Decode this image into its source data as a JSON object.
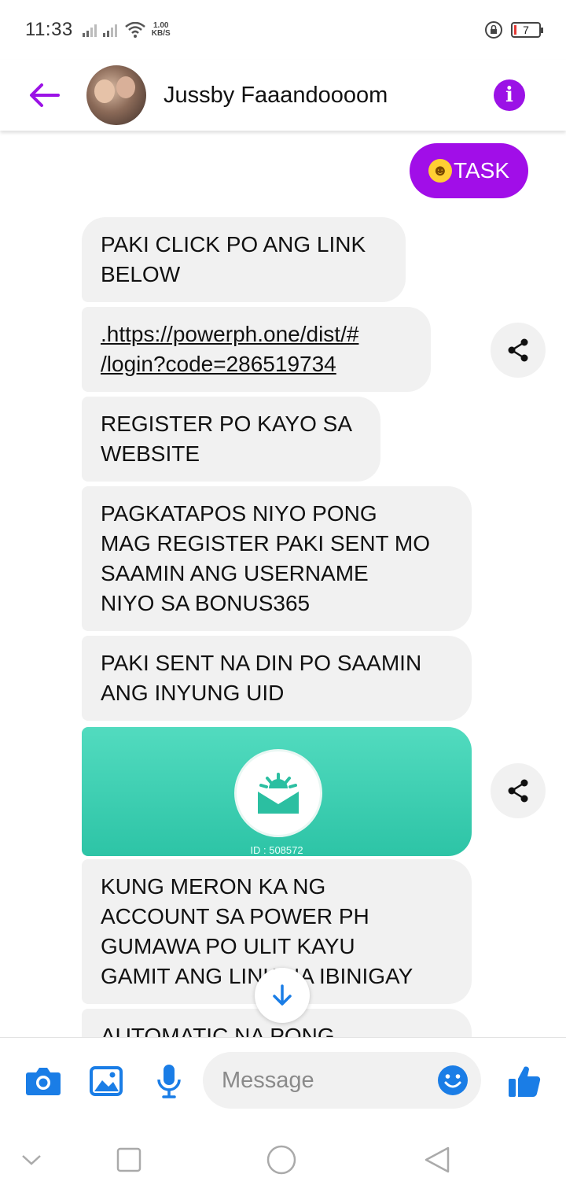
{
  "status_bar": {
    "time": "11:33",
    "net_speed_value": "1.00",
    "net_speed_unit": "KB/S",
    "battery_level": "7"
  },
  "header": {
    "contact_name": "Jussby Faaandoooom",
    "back_icon": "arrow-left-icon",
    "info_icon": "info-icon"
  },
  "messages": {
    "outgoing": [
      {
        "text": "TASK",
        "emoji": "grinning-face"
      }
    ],
    "incoming": [
      {
        "lines": [
          "PAKI CLICK PO ANG LINK",
          "BELOW"
        ]
      },
      {
        "lines": [
          ".https://powerph.one/dist/#",
          "/login?code=286519734"
        ],
        "is_link": true
      },
      {
        "lines": [
          "REGISTER PO KAYO SA",
          "WEBSITE"
        ]
      },
      {
        "lines": [
          "PAGKATAPOS NIYO PONG",
          "MAG REGISTER PAKI SENT MO",
          "SAAMIN ANG USERNAME",
          "NIYO SA BONUS365"
        ]
      },
      {
        "lines": [
          "PAKI SENT NA DIN PO SAAMIN",
          "ANG INYUNG UID"
        ]
      },
      {
        "lines": [
          "KUNG MERON KA NG",
          "ACCOUNT SA POWER PH",
          "GUMAWA PO ULIT KAYU",
          "GAMIT ANG LINK NA IBINIGAY"
        ]
      },
      {
        "lines": [
          "AUTOMATIC NA PONG"
        ]
      }
    ],
    "image_card": {
      "id_text": "ID : 508572",
      "icon": "envelope-sun-icon"
    }
  },
  "composer": {
    "placeholder": "Message",
    "icons": [
      "camera-icon",
      "image-icon",
      "microphone-icon",
      "emoji-icon",
      "thumbs-up-icon"
    ]
  },
  "colors": {
    "accent": "#a10ee8",
    "messenger_blue": "#1a7de6",
    "incoming_bubble": "#f1f1f1",
    "image_card": "#3fd0b2"
  },
  "nav_bar": {
    "icons": [
      "back-chevron-icon",
      "recents-icon",
      "home-icon",
      "back-triangle-icon"
    ]
  }
}
